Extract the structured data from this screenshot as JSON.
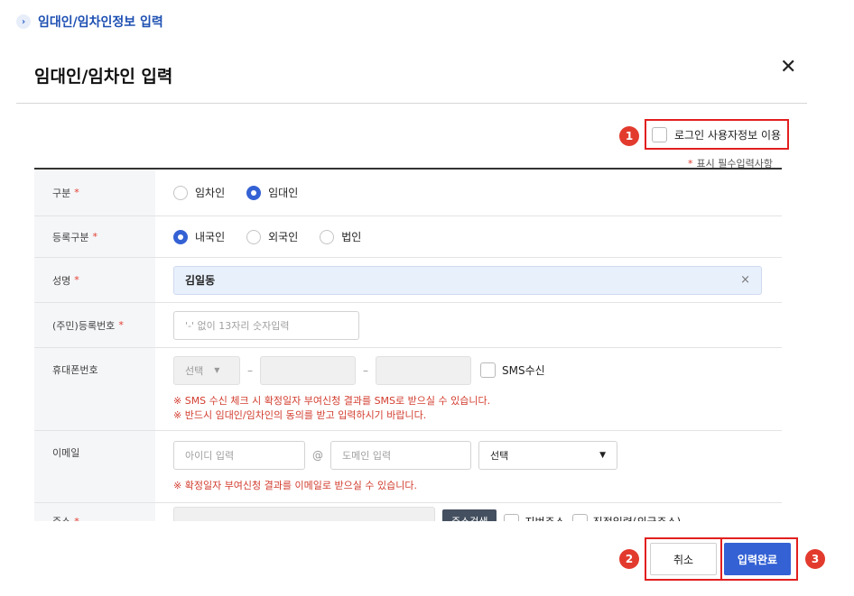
{
  "section": {
    "title": "임대인/임차인정보 입력"
  },
  "modal": {
    "title": "임대인/임차인 입력",
    "login_checkbox_label": "로그인 사용자정보 이용",
    "required_note": "표시 필수입력사항",
    "required_star": "*"
  },
  "markers": {
    "m1": "1",
    "m2": "2",
    "m3": "3"
  },
  "form": {
    "type": {
      "label": "구분",
      "req": "*",
      "options": [
        "임차인",
        "임대인"
      ],
      "selected": "임대인"
    },
    "reg_type": {
      "label": "등록구분",
      "req": "*",
      "options": [
        "내국인",
        "외국인",
        "법인"
      ],
      "selected": "내국인"
    },
    "name": {
      "label": "성명",
      "req": "*",
      "value": "김일동",
      "clear_icon": "×"
    },
    "resident_no": {
      "label": "(주민)등록번호",
      "req": "*",
      "placeholder": "'-' 없이 13자리 숫자입력"
    },
    "phone": {
      "label": "휴대폰번호",
      "select_value": "선택",
      "select_caret": "▼",
      "dash": "–",
      "sms_label": "SMS수신",
      "notice1": "※ SMS 수신 체크 시 확정일자 부여신청 결과를 SMS로 받으실 수 있습니다.",
      "notice2": "※ 반드시 임대인/임차인의 동의를 받고 입력하시기 바랍니다."
    },
    "email": {
      "label": "이메일",
      "id_placeholder": "아이디 입력",
      "at": "@",
      "domain_placeholder": "도메인 입력",
      "select_value": "선택",
      "select_caret": "▼",
      "notice": "※ 확정일자 부여신청 결과를 이메일로 받으실 수 있습니다."
    },
    "address": {
      "label": "주소",
      "req": "*",
      "search_button": "주소검색",
      "lot_label": "지번주소",
      "direct_label": "직접입력(외국주소)"
    }
  },
  "buttons": {
    "cancel": "취소",
    "submit": "입력완료"
  },
  "colors": {
    "accent": "#3461d4",
    "required": "#e23b2e",
    "highlight_box": "#e21f1f"
  }
}
